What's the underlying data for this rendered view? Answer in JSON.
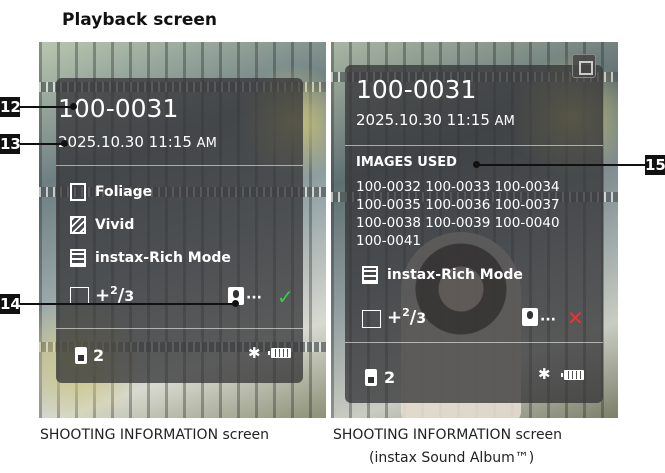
{
  "title": "Playback screen",
  "left_screen": {
    "file_number": "100-0031",
    "date": "2025.10.30  11:15",
    "ampm": "AM",
    "film_type": "Foliage",
    "filter": "Vivid",
    "print_mode": "instax-Rich Mode",
    "exposure_whole": "+",
    "exposure_num": "2",
    "exposure_den": "3",
    "audio_dots": "···",
    "audio_status": "✓",
    "card_count": "2",
    "bluetooth": "✱"
  },
  "right_screen": {
    "file_number": "100-0031",
    "date": "2025.10.30  11:15",
    "ampm": "AM",
    "images_used_label": "IMAGES USED",
    "images_used": [
      "100-0032 100-0033 100-0034",
      "100-0035 100-0036 100-0037",
      "100-0038 100-0039 100-0040",
      "100-0041"
    ],
    "print_mode": "instax-Rich Mode",
    "exposure_whole": "+",
    "exposure_num": "2",
    "exposure_den": "3",
    "audio_dots": "···",
    "audio_status": "✕",
    "card_count": "2",
    "bluetooth": "✱"
  },
  "callouts": {
    "c12": "12",
    "c13": "13",
    "c14": "14",
    "c15": "15"
  },
  "captions": {
    "left": "SHOOTING INFORMATION screen",
    "right_line1": "SHOOTING INFORMATION screen",
    "right_line2": "(instax Sound Album™)"
  },
  "colors": {
    "panel": "#37373a",
    "check": "#2dd14a",
    "cross": "#ff2b2b",
    "callout": "#111111"
  }
}
